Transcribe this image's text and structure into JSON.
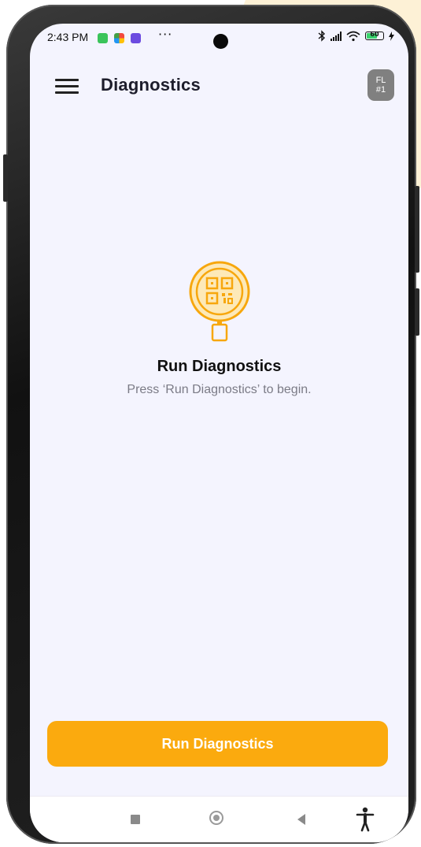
{
  "status_bar": {
    "time": "2:43 PM",
    "more": "···",
    "battery_level": "60",
    "battery_charging": true
  },
  "app_bar": {
    "title": "Diagnostics",
    "menu_icon": "hamburger-menu-icon",
    "avatar_line1": "FL",
    "avatar_line2": "#1"
  },
  "empty_state": {
    "icon": "qr-search-icon",
    "title": "Run Diagnostics",
    "subtitle": "Press ‘Run Diagnostics’ to begin."
  },
  "actions": {
    "run_label": "Run Diagnostics"
  },
  "nav_bar": {
    "recent_icon": "recent-apps-icon",
    "home_icon": "home-icon",
    "back_icon": "back-icon",
    "accessibility_icon": "accessibility-icon"
  },
  "colors": {
    "accent": "#FBAA0E",
    "screen_bg": "#F4F4FE",
    "avatar_bg": "#808080",
    "subtitle": "#7B7B86"
  }
}
